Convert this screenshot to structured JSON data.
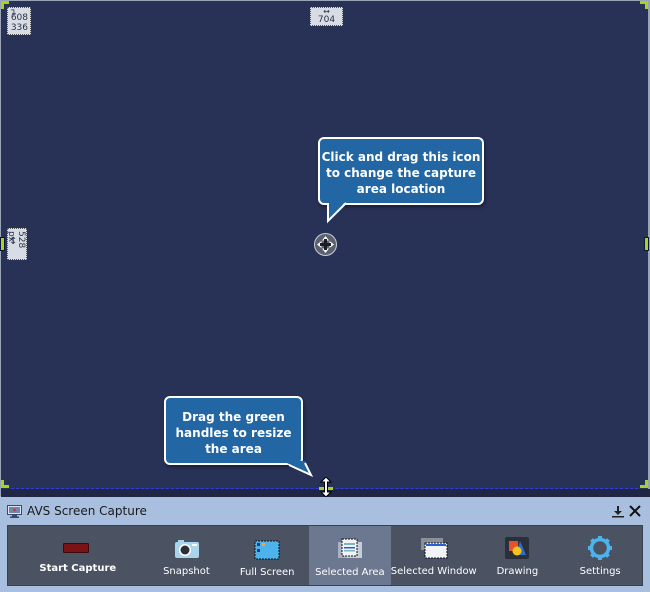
{
  "capture_area": {
    "position_readout": {
      "x": "608",
      "y": "336"
    },
    "width_readout": "704 px",
    "height_readout": "528 px",
    "colors": {
      "background": "#283156",
      "handles": "#a5d325",
      "dashed_border": "#2a3ef0"
    }
  },
  "tooltips": {
    "move": "Click and drag this icon to change the capture area location",
    "move_lines": [
      "Click and drag this icon",
      "to change the capture",
      "area location"
    ],
    "resize": "Drag the green handles to resize the area",
    "resize_lines": [
      "Drag the green",
      "handles to resize",
      "the area"
    ],
    "color": "#2366a4"
  },
  "panel": {
    "title": "AVS Screen Capture",
    "app_icon": "monitor-icon",
    "controls": {
      "pin": "pin-icon",
      "close": "close-icon"
    },
    "tools": [
      {
        "id": "start-capture",
        "label": "Start Capture",
        "icon": "record-icon",
        "active": false
      },
      {
        "id": "snapshot",
        "label": "Snapshot",
        "icon": "camera-icon",
        "active": false
      },
      {
        "id": "full-screen",
        "label": "Full Screen",
        "icon": "full-screen-icon",
        "active": false
      },
      {
        "id": "selected-area",
        "label": "Selected Area",
        "icon": "selected-area-icon",
        "active": true
      },
      {
        "id": "selected-window",
        "label": "Selected Window",
        "icon": "selected-window-icon",
        "active": false
      },
      {
        "id": "drawing",
        "label": "Drawing",
        "icon": "drawing-icon",
        "active": false
      },
      {
        "id": "settings",
        "label": "Settings",
        "icon": "gear-icon",
        "active": false
      }
    ]
  }
}
